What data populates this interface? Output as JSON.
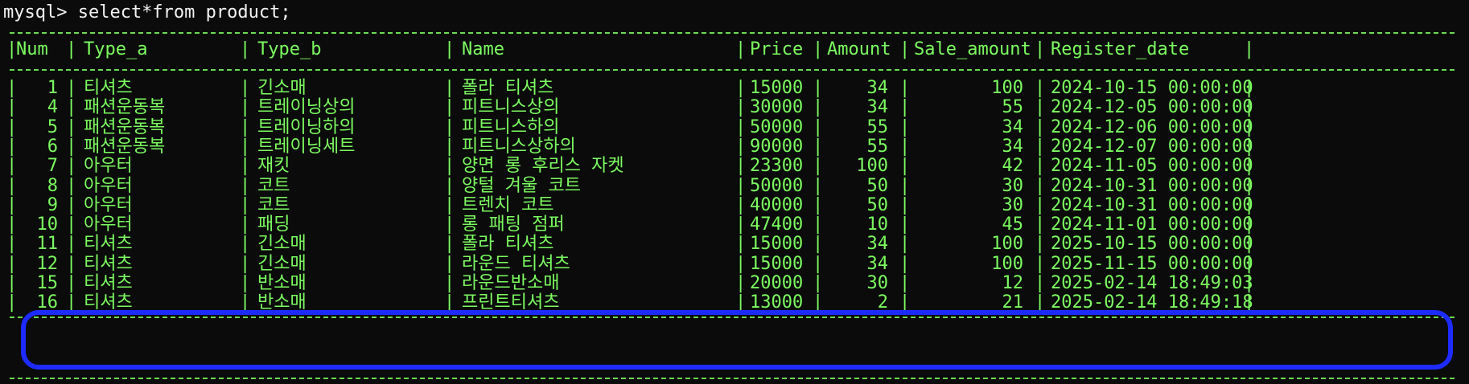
{
  "terminal": {
    "prompt": "mysql> select*from product;",
    "columns": [
      "Num",
      "Type_a",
      "Type_b",
      "Name",
      "Price",
      "Amount",
      "Sale_amount",
      "Register_date"
    ],
    "rows": [
      [
        "1",
        "티셔츠",
        "긴소매",
        "폴라 티셔츠",
        "15000",
        "34",
        "100",
        "2024-10-15 00:00:00"
      ],
      [
        "4",
        "패션운동복",
        "트레이닝상의",
        "피트니스상의",
        "30000",
        "34",
        "55",
        "2024-12-05 00:00:00"
      ],
      [
        "5",
        "패션운동복",
        "트레이닝하의",
        "피트니스하의",
        "50000",
        "55",
        "34",
        "2024-12-06 00:00:00"
      ],
      [
        "6",
        "패션운동복",
        "트레이닝세트",
        "피트니스상하의",
        "90000",
        "55",
        "34",
        "2024-12-07 00:00:00"
      ],
      [
        "7",
        "아우터",
        "재킷",
        "양면 롱 후리스 자켓",
        "23300",
        "100",
        "42",
        "2024-11-05 00:00:00"
      ],
      [
        "8",
        "아우터",
        "코트",
        "양털 겨울 코트",
        "50000",
        "50",
        "30",
        "2024-10-31 00:00:00"
      ],
      [
        "9",
        "아우터",
        "코트",
        "트렌치 코트",
        "40000",
        "50",
        "30",
        "2024-10-31 00:00:00"
      ],
      [
        "10",
        "아우터",
        "패딩",
        "롱 패팅 점퍼",
        "47400",
        "10",
        "45",
        "2024-11-01 00:00:00"
      ],
      [
        "11",
        "티셔츠",
        "긴소매",
        "폴라 티셔츠",
        "15000",
        "34",
        "100",
        "2025-10-15 00:00:00"
      ],
      [
        "12",
        "티셔츠",
        "긴소매",
        "라운드 티셔츠",
        "15000",
        "34",
        "100",
        "2025-11-15 00:00:00"
      ],
      [
        "15",
        "티셔츠",
        "반소매",
        "라운드반소매",
        "20000",
        "30",
        "12",
        "2025-02-14 18:49:03"
      ],
      [
        "16",
        "티셔츠",
        "반소매",
        "프린트티셔츠",
        "13000",
        "2",
        "21",
        "2025-02-14 18:49:18"
      ]
    ]
  },
  "colors": {
    "text": "#7CFC60",
    "prompt": "#f2f2f2",
    "background": "#0b0b0b",
    "highlight": "#1e2bff"
  }
}
